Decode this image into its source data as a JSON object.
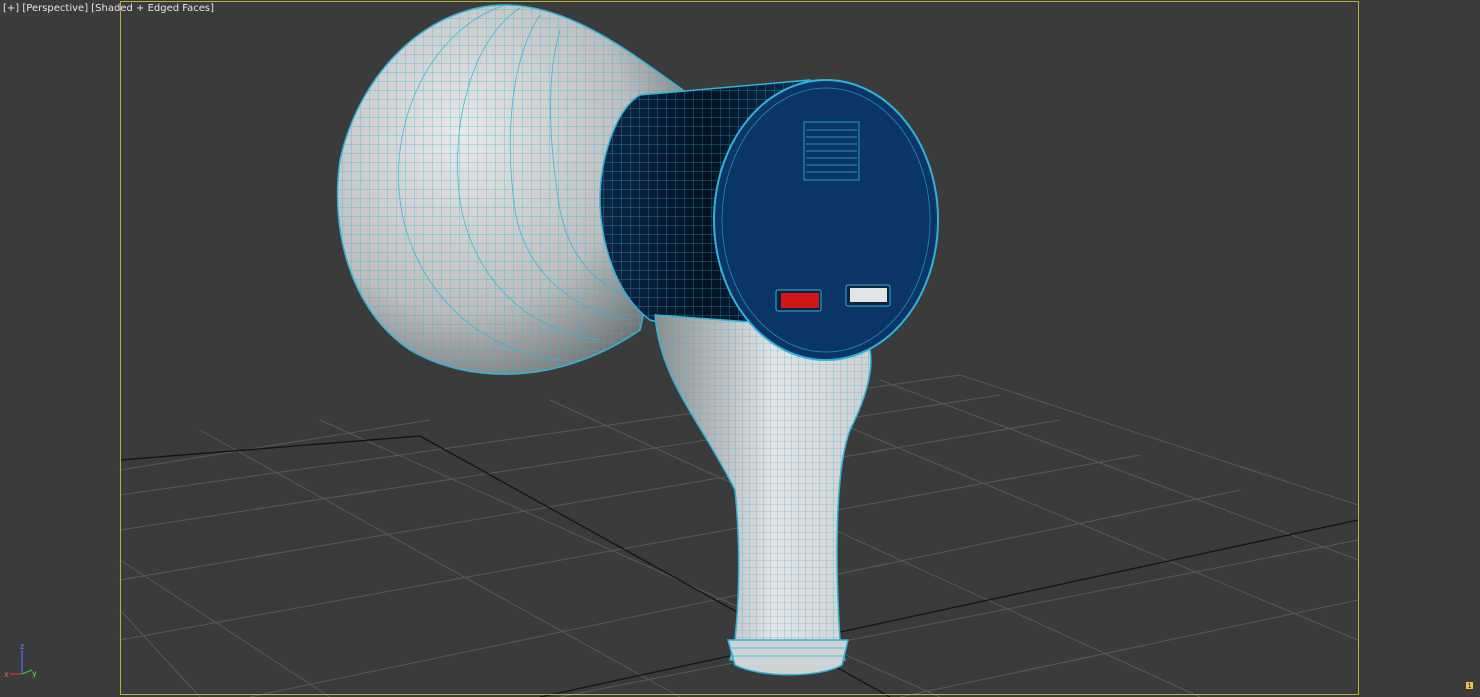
{
  "viewport": {
    "label_plus": "[+]",
    "label_view": "[Perspective]",
    "label_shading": "[Shaded + Edged Faces]"
  },
  "axis": {
    "x": "x",
    "y": "y",
    "z": "z"
  },
  "colors": {
    "background": "#3b3b3b",
    "grid": "#5a5a5a",
    "grid_center": "#111111",
    "safe_frame": "#b9b23a",
    "wire": "#2fb4d8",
    "body_blue": "#0a3566",
    "horn_white": "#d9d9d9",
    "button_red": "#d11616",
    "button_white": "#e3e3e3"
  },
  "icons": {
    "axis_tripod": "axis-tripod-icon",
    "corner_badge": "viewport-badge-icon"
  },
  "corner_badge_text": "1"
}
